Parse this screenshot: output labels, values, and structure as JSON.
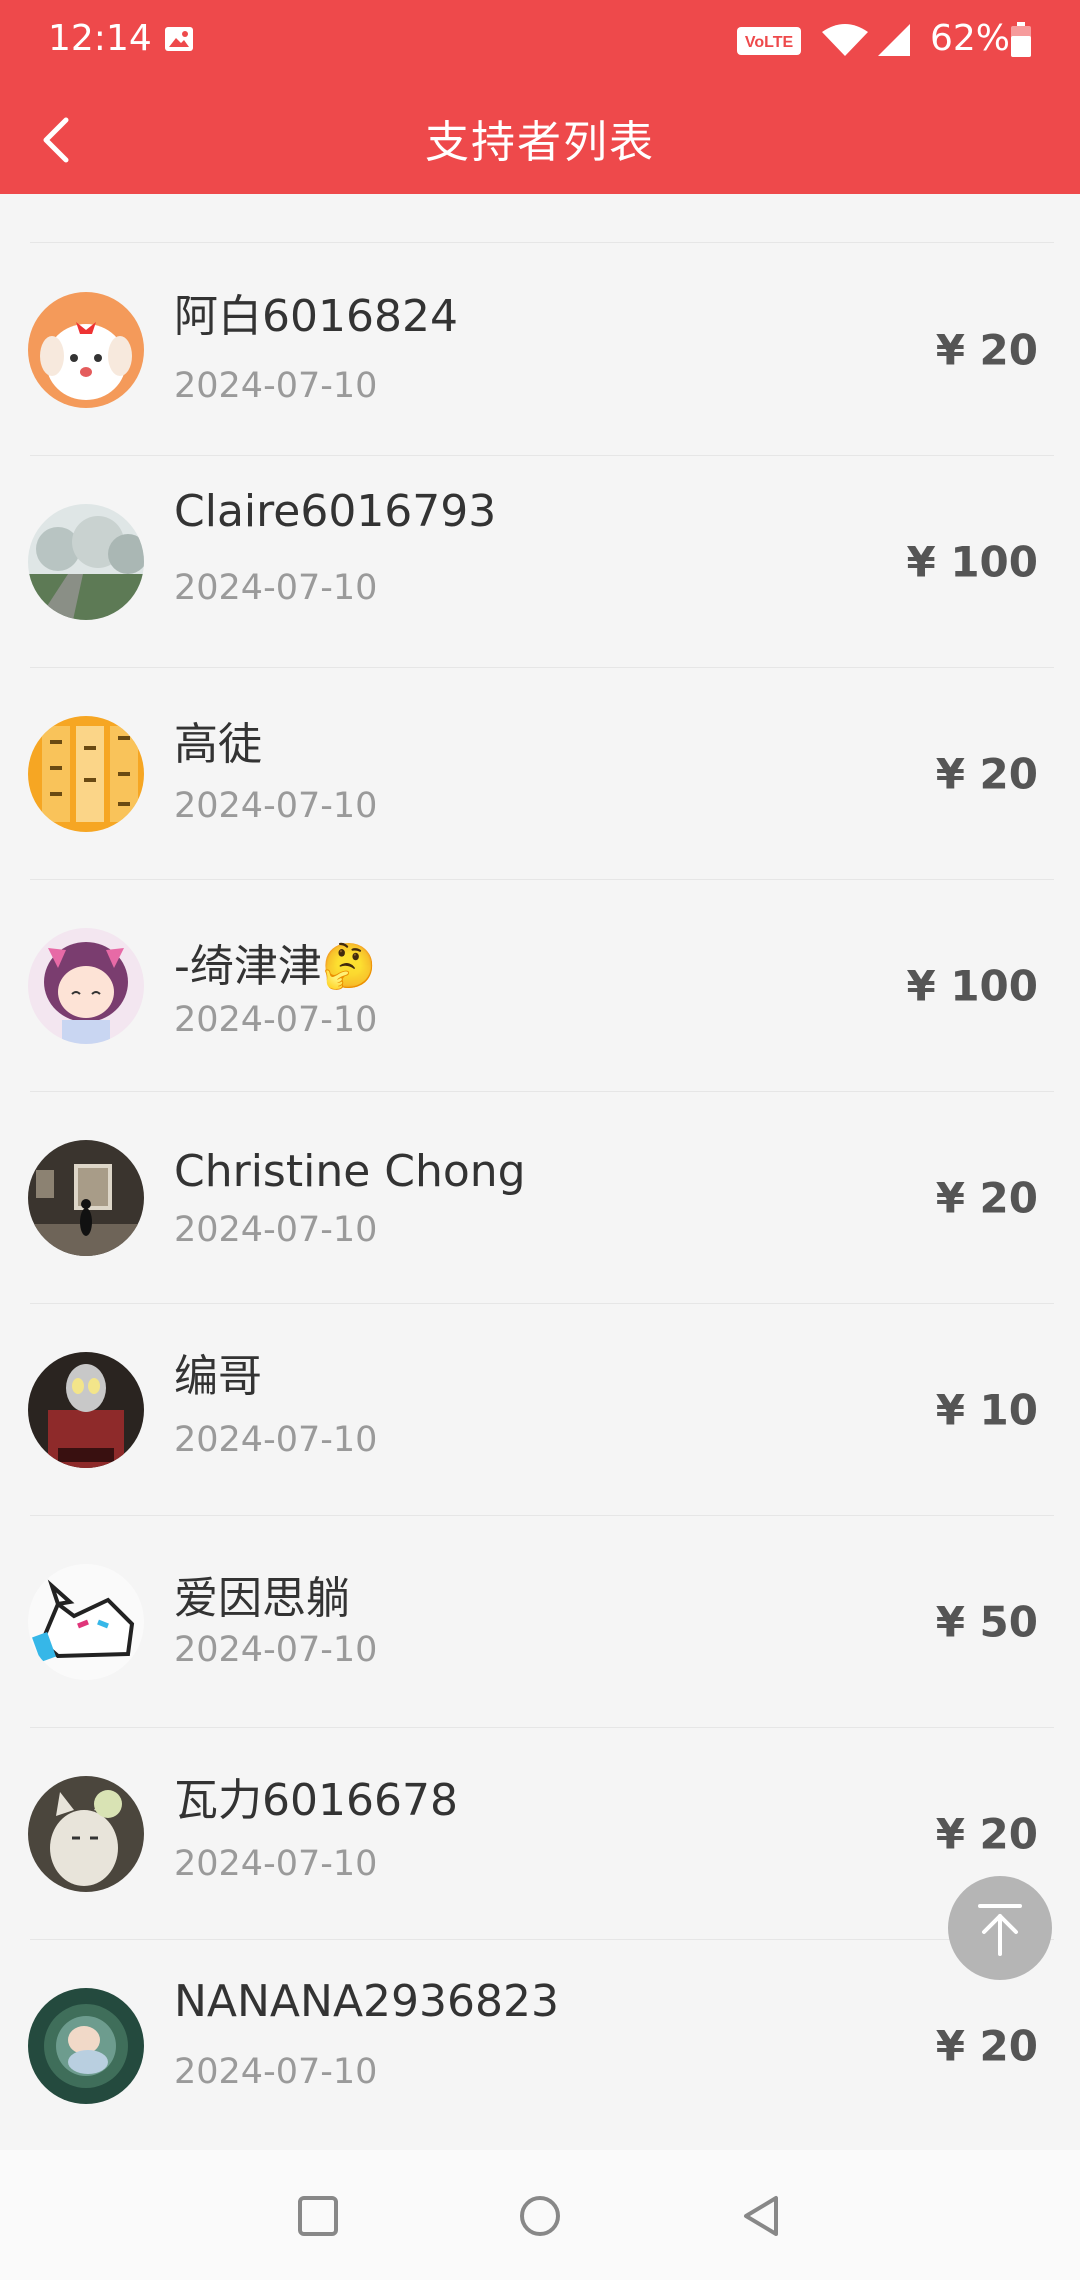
{
  "status_bar": {
    "time": "12:14",
    "volte": "VoLTE",
    "battery": "62%"
  },
  "header": {
    "title": "支持者列表",
    "back_icon": "chevron-left-icon"
  },
  "supporters": [
    {
      "name": "阿白6016824",
      "date": "2024-07-10",
      "amount": "¥ 20",
      "avatar": "cartoon-dog"
    },
    {
      "name": "Claire6016793",
      "date": "2024-07-10",
      "amount": "¥ 100",
      "avatar": "trees"
    },
    {
      "name": "高徒",
      "date": "2024-07-10",
      "amount": "¥ 20",
      "avatar": "calligraphy"
    },
    {
      "name": "-绮津津🤔",
      "date": "2024-07-10",
      "amount": "¥ 100",
      "avatar": "anime-girl"
    },
    {
      "name": "Christine Chong",
      "date": "2024-07-10",
      "amount": "¥ 20",
      "avatar": "gallery"
    },
    {
      "name": "编哥",
      "date": "2024-07-10",
      "amount": "¥ 10",
      "avatar": "ultraman"
    },
    {
      "name": "爱因思躺",
      "date": "2024-07-10",
      "amount": "¥ 50",
      "avatar": "cartoon-cat"
    },
    {
      "name": "瓦力6016678",
      "date": "2024-07-10",
      "amount": "¥ 20",
      "avatar": "cat-flower"
    },
    {
      "name": "NANANA2936823",
      "date": "2024-07-10",
      "amount": "¥ 20",
      "avatar": "baby"
    }
  ],
  "colors": {
    "header_bg": "#ee494b",
    "amount": "#555555",
    "date": "#9a9a9a"
  }
}
